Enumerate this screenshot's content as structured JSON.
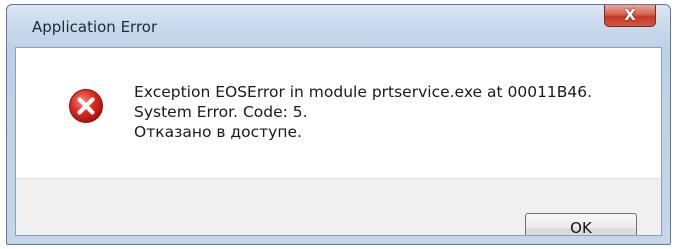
{
  "window": {
    "title": "Application Error",
    "close_label": "X"
  },
  "message": {
    "icon": "error-icon",
    "lines": [
      "Exception EOSError in module prtservice.exe at 00011B46.",
      "System Error.  Code: 5.",
      "Отказано в доступе."
    ]
  },
  "footer": {
    "ok_label": "OK"
  },
  "colors": {
    "error_red": "#d9271f",
    "close_button": "#c4382a",
    "frame": "#c4d6ea"
  }
}
